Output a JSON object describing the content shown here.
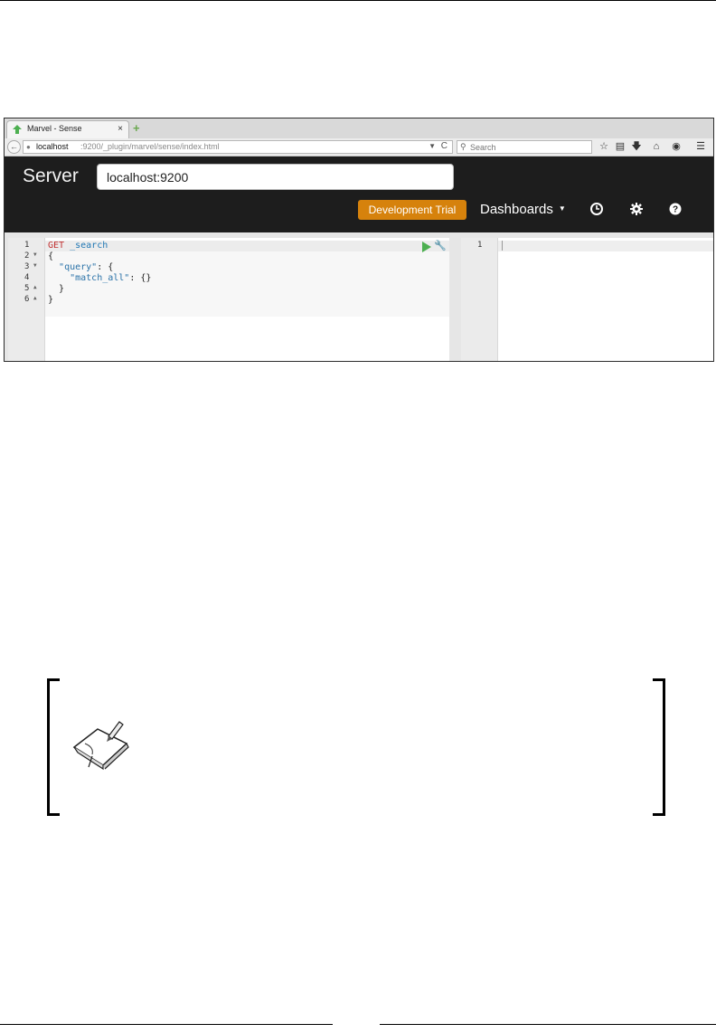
{
  "browser": {
    "tab_title": "Marvel - Sense",
    "tab_close": "×",
    "new_tab": "+",
    "url_host": "localhost",
    "url_path": ":9200/_plugin/marvel/sense/index.html",
    "search_placeholder": "Search",
    "toolbar_icons": [
      "star-icon",
      "clipboard-icon",
      "download-icon",
      "home-icon",
      "chat-icon",
      "menu-icon"
    ]
  },
  "app": {
    "server_label": "Server",
    "server_value": "localhost:9200",
    "dev_trial_label": "Development Trial",
    "dashboards_label": "Dashboards",
    "header_icons": [
      "clock-icon",
      "gear-icon",
      "help-icon"
    ],
    "accent_color": "#d6820c"
  },
  "editor": {
    "line_numbers": [
      "1",
      "2",
      "3",
      "4",
      "5",
      "6"
    ],
    "lines": [
      {
        "method": "GET",
        "path": "_search"
      },
      {
        "text": "{"
      },
      {
        "indent": "  ",
        "key": "\"query\"",
        "rest": ": {"
      },
      {
        "indent": "    ",
        "key": "\"match_all\"",
        "rest": ": {}"
      },
      {
        "text": "  }"
      },
      {
        "text": "}"
      }
    ]
  },
  "response": {
    "line_numbers": [
      "1"
    ]
  }
}
